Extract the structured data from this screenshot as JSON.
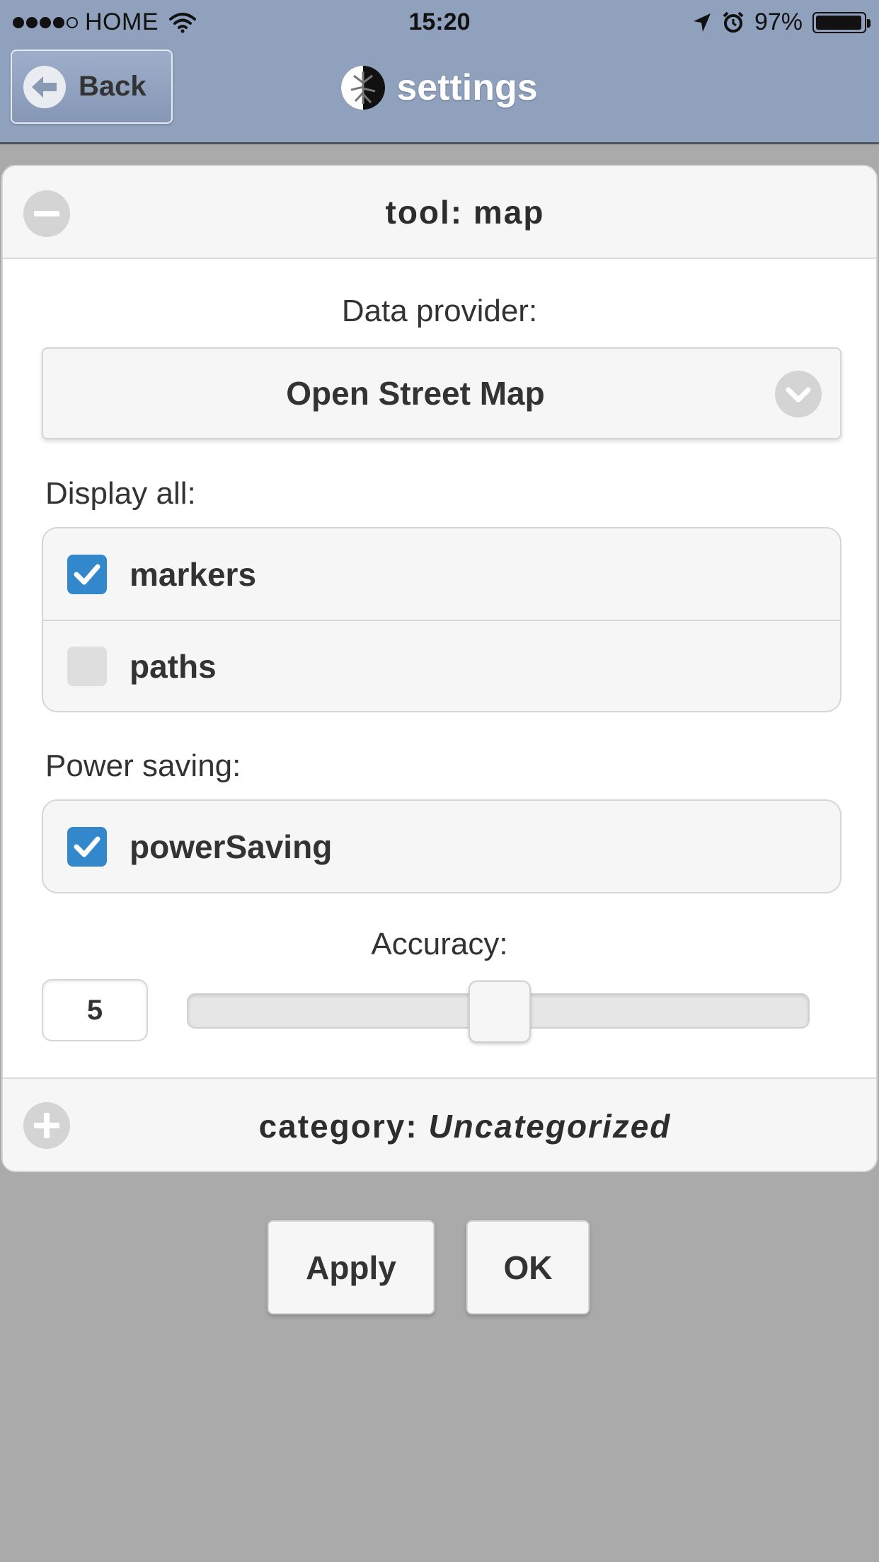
{
  "status_bar": {
    "carrier": "HOME",
    "time": "15:20",
    "battery_text": "97%",
    "battery_level": 0.97,
    "icons": [
      "signal-dots-icon",
      "wifi-icon",
      "location-arrow-icon",
      "alarm-icon",
      "battery-icon"
    ]
  },
  "header": {
    "back_label": "Back",
    "title": "settings"
  },
  "panel": {
    "tool_heading": "tool: map",
    "data_provider_label": "Data provider:",
    "data_provider_value": "Open Street Map",
    "display_all_label": "Display all:",
    "display_items": [
      {
        "label": "markers",
        "checked": true
      },
      {
        "label": "paths",
        "checked": false
      }
    ],
    "power_saving_label": "Power saving:",
    "power_items": [
      {
        "label": "powerSaving",
        "checked": true
      }
    ],
    "accuracy_label": "Accuracy:",
    "accuracy_value": "5",
    "accuracy_level": 0.5,
    "category_prefix": "category:",
    "category_value": "Uncategorized"
  },
  "actions": {
    "apply_label": "Apply",
    "ok_label": "OK"
  },
  "colors": {
    "header_bg": "#8fa1bd",
    "page_bg": "#aaaaaa",
    "checkbox_on": "#3388cc"
  }
}
